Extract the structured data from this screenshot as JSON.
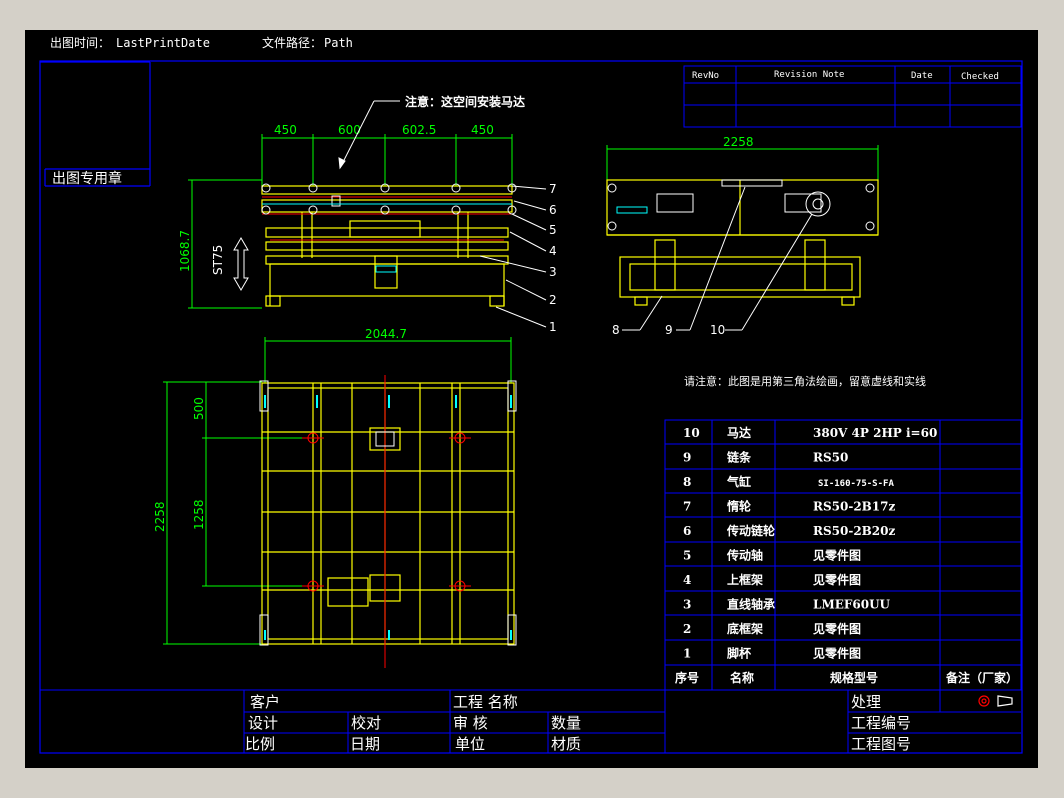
{
  "header": {
    "print_date_label": "出图时间：",
    "print_date_value": "LastPrintDate",
    "path_label": "文件路径：",
    "path_value": "Path"
  },
  "stamp_label": "出图专用章",
  "revision_table": {
    "headers": [
      "RevNo",
      "Revision Note",
      "Date",
      "Checked"
    ]
  },
  "front_view": {
    "note": "注意：这空间安装马达",
    "top_dims": [
      "450",
      "600",
      "602.5",
      "450"
    ],
    "height_dim": "1068.7",
    "stroke_dim": "ST75",
    "balloons": [
      "7",
      "6",
      "5",
      "4",
      "3",
      "2",
      "1"
    ]
  },
  "side_view": {
    "width_dim": "2258",
    "balloons": [
      "8",
      "9",
      "10"
    ]
  },
  "top_view": {
    "width_dim": "2044.7",
    "side_dims": [
      "500",
      "1258",
      "2258"
    ]
  },
  "projection_note": "请注意：此图是用第三角法绘画，留意虚线和实线",
  "bom": {
    "headers": {
      "no": "序号",
      "name": "名称",
      "spec": "规格型号",
      "remark": "备注（厂家）"
    },
    "rows": [
      {
        "no": "10",
        "name": "马达",
        "spec": "380V 4P 2HP i=60"
      },
      {
        "no": "9",
        "name": "链条",
        "spec": "RS50"
      },
      {
        "no": "8",
        "name": "气缸",
        "spec": "SI-160-75-S-FA"
      },
      {
        "no": "7",
        "name": "惰轮",
        "spec": "RS50-2B17z"
      },
      {
        "no": "6",
        "name": "传动链轮",
        "spec": "RS50-2B20z"
      },
      {
        "no": "5",
        "name": "传动轴",
        "spec": "见零件图"
      },
      {
        "no": "4",
        "name": "上框架",
        "spec": "见零件图"
      },
      {
        "no": "3",
        "name": "直线轴承",
        "spec": "LMEF60UU"
      },
      {
        "no": "2",
        "name": "底框架",
        "spec": "见零件图"
      },
      {
        "no": "1",
        "name": "脚杯",
        "spec": "见零件图"
      }
    ]
  },
  "title_block": {
    "customer": "客户",
    "project_name": "工程 名称",
    "process": "处理",
    "design": "设计",
    "proofread": "校对",
    "review": "审 核",
    "quantity": "数量",
    "project_no": "工程编号",
    "scale": "比例",
    "date": "日期",
    "unit": "单位",
    "material": "材质",
    "drawing_no": "工程图号"
  },
  "colors": {
    "background": "#000000",
    "frame": "#0000ff",
    "dimension": "#00ff00",
    "part": "#ffff00",
    "highlight": "#ff0000",
    "accent": "#00ffff",
    "text": "#ffffff"
  }
}
